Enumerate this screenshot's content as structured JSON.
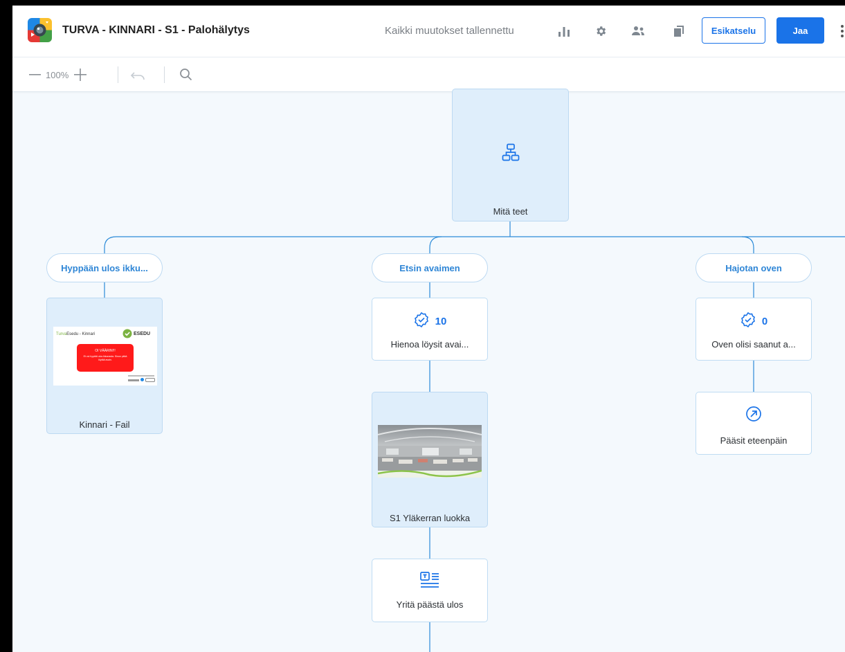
{
  "header": {
    "title": "TURVA - KINNARI - S1 - Palohälytys",
    "save_status": "Kaikki muutokset tallennettu",
    "preview_label": "Esikatselu",
    "share_label": "Jaa",
    "icons": [
      "stats-icon",
      "settings-icon",
      "users-icon",
      "copy-icon",
      "more-icon"
    ]
  },
  "toolbar": {
    "zoom_level": "100%"
  },
  "tree": {
    "root": {
      "label": "Mitä teet",
      "icon": "sitemap-icon"
    },
    "choices": [
      {
        "label": "Hyppään ulos ikku..."
      },
      {
        "label": "Etsin avaimen"
      },
      {
        "label": "Hajotan oven"
      }
    ],
    "nodes": {
      "fail_scene": {
        "label": "Kinnari - Fail",
        "thumb": {
          "brand": "Turva",
          "brand_rest": "Esedu - Kinnari",
          "logo_text": "ESEDU",
          "banner_title": "OI VÄÄRIN!!!",
          "banner_text": "Et voi hypätä ulos ikkunasta. Sinun pitää löytää avain."
        }
      },
      "key_score": {
        "score": "10",
        "label": "Hienoa löysit avai..."
      },
      "door_score": {
        "score": "0",
        "label": "Oven olisi saanut a..."
      },
      "class_scene": {
        "label": "S1 Yläkerran luokka"
      },
      "forward": {
        "label": "Pääsit eteenpäin",
        "icon": "arrow-up-right-icon"
      },
      "text_node": {
        "label": "Yritä päästä ulos",
        "icon": "text-icon"
      }
    }
  },
  "colors": {
    "accent": "#1a73e8",
    "connector": "#2a8ad8",
    "node_border": "#bfdcf3",
    "scene_bg": "#dfeefb"
  }
}
